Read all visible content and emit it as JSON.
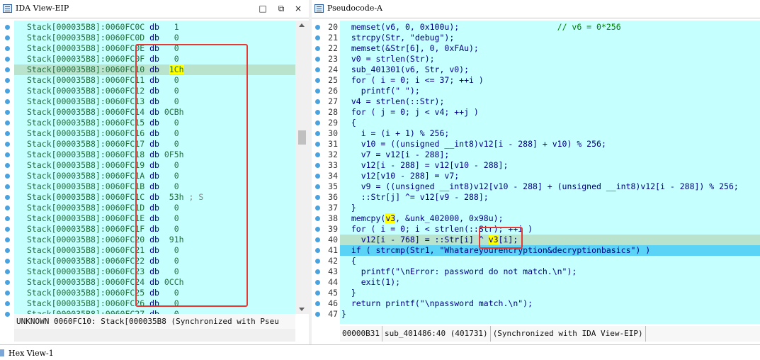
{
  "left_panel": {
    "title": "IDA View-EIP",
    "minimize_glyph": "□",
    "restore_glyph": "⧉",
    "close_glyph": "×",
    "lines": [
      {
        "addr": "Stack[000035B8]:0060FC0C",
        "op": "db",
        "val": "   1",
        "cmt": ""
      },
      {
        "addr": "Stack[000035B8]:0060FC0D",
        "op": "db",
        "val": "   0",
        "cmt": ""
      },
      {
        "addr": "Stack[000035B8]:0060FC0E",
        "op": "db",
        "val": "   0",
        "cmt": ""
      },
      {
        "addr": "Stack[000035B8]:0060FC0F",
        "op": "db",
        "val": "   0",
        "cmt": ""
      },
      {
        "addr": "Stack[000035B8]:0060FC10",
        "op": "db",
        "val": "  1Ch",
        "cmt": ""
      },
      {
        "addr": "Stack[000035B8]:0060FC11",
        "op": "db",
        "val": "   0",
        "cmt": ""
      },
      {
        "addr": "Stack[000035B8]:0060FC12",
        "op": "db",
        "val": "   0",
        "cmt": ""
      },
      {
        "addr": "Stack[000035B8]:0060FC13",
        "op": "db",
        "val": "   0",
        "cmt": ""
      },
      {
        "addr": "Stack[000035B8]:0060FC14",
        "op": "db",
        "val": " 0CBh",
        "cmt": ""
      },
      {
        "addr": "Stack[000035B8]:0060FC15",
        "op": "db",
        "val": "   0",
        "cmt": ""
      },
      {
        "addr": "Stack[000035B8]:0060FC16",
        "op": "db",
        "val": "   0",
        "cmt": ""
      },
      {
        "addr": "Stack[000035B8]:0060FC17",
        "op": "db",
        "val": "   0",
        "cmt": ""
      },
      {
        "addr": "Stack[000035B8]:0060FC18",
        "op": "db",
        "val": " 0F5h",
        "cmt": ""
      },
      {
        "addr": "Stack[000035B8]:0060FC19",
        "op": "db",
        "val": "   0",
        "cmt": ""
      },
      {
        "addr": "Stack[000035B8]:0060FC1A",
        "op": "db",
        "val": "   0",
        "cmt": ""
      },
      {
        "addr": "Stack[000035B8]:0060FC1B",
        "op": "db",
        "val": "   0",
        "cmt": ""
      },
      {
        "addr": "Stack[000035B8]:0060FC1C",
        "op": "db",
        "val": "  53h",
        "cmt": " ; S"
      },
      {
        "addr": "Stack[000035B8]:0060FC1D",
        "op": "db",
        "val": "   0",
        "cmt": ""
      },
      {
        "addr": "Stack[000035B8]:0060FC1E",
        "op": "db",
        "val": "   0",
        "cmt": ""
      },
      {
        "addr": "Stack[000035B8]:0060FC1F",
        "op": "db",
        "val": "   0",
        "cmt": ""
      },
      {
        "addr": "Stack[000035B8]:0060FC20",
        "op": "db",
        "val": "  91h",
        "cmt": ""
      },
      {
        "addr": "Stack[000035B8]:0060FC21",
        "op": "db",
        "val": "   0",
        "cmt": ""
      },
      {
        "addr": "Stack[000035B8]:0060FC22",
        "op": "db",
        "val": "   0",
        "cmt": ""
      },
      {
        "addr": "Stack[000035B8]:0060FC23",
        "op": "db",
        "val": "   0",
        "cmt": ""
      },
      {
        "addr": "Stack[000035B8]:0060FC24",
        "op": "db",
        "val": " 0CCh",
        "cmt": ""
      },
      {
        "addr": "Stack[000035B8]:0060FC25",
        "op": "db",
        "val": "   0",
        "cmt": ""
      },
      {
        "addr": "Stack[000035B8]:0060FC26",
        "op": "db",
        "val": "   0",
        "cmt": ""
      },
      {
        "addr": "Stack[000035B8]:0060FC27",
        "op": "db",
        "val": "   0",
        "cmt": ""
      }
    ],
    "status_text": "UNKNOWN 0060FC10: Stack[000035B8 (Synchronized with Pseu"
  },
  "right_panel": {
    "title": "Pseudocode-A",
    "lines": [
      {
        "num": "20",
        "code": "  memset(v6, 0, 0x100u);                    // v6 = 0*256"
      },
      {
        "num": "21",
        "code": "  strcpy(Str, \"debug\");"
      },
      {
        "num": "22",
        "code": "  memset(&Str[6], 0, 0xFAu);"
      },
      {
        "num": "23",
        "code": "  v0 = strlen(Str);"
      },
      {
        "num": "24",
        "code": "  sub_401301(v6, Str, v0);"
      },
      {
        "num": "25",
        "code": "  for ( i = 0; i <= 37; ++i )"
      },
      {
        "num": "26",
        "code": "    printf(\" \");"
      },
      {
        "num": "27",
        "code": "  v4 = strlen(::Str);"
      },
      {
        "num": "28",
        "code": "  for ( j = 0; j < v4; ++j )"
      },
      {
        "num": "29",
        "code": "  {"
      },
      {
        "num": "30",
        "code": "    i = (i + 1) % 256;"
      },
      {
        "num": "31",
        "code": "    v10 = ((unsigned __int8)v12[i - 288] + v10) % 256;"
      },
      {
        "num": "32",
        "code": "    v7 = v12[i - 288];"
      },
      {
        "num": "33",
        "code": "    v12[i - 288] = v12[v10 - 288];"
      },
      {
        "num": "34",
        "code": "    v12[v10 - 288] = v7;"
      },
      {
        "num": "35",
        "code": "    v9 = ((unsigned __int8)v12[v10 - 288] + (unsigned __int8)v12[i - 288]) % 256;"
      },
      {
        "num": "36",
        "code": "    ::Str[j] ^= v12[v9 - 288];"
      },
      {
        "num": "37",
        "code": "  }"
      },
      {
        "num": "38",
        "code": "  memcpy(v3, &unk_402000, 0x98u);"
      },
      {
        "num": "39",
        "code": "  for ( i = 0; i < strlen(::Str); ++i )"
      },
      {
        "num": "40",
        "code": "    v12[i - 768] = ::Str[i] ^ v3[i];"
      },
      {
        "num": "41",
        "code": "  if ( strcmp(Str1, \"Whatareyourencryption&decryptionbasics\") )"
      },
      {
        "num": "42",
        "code": "  {"
      },
      {
        "num": "43",
        "code": "    printf(\"\\nError: password do not match.\\n\");"
      },
      {
        "num": "44",
        "code": "    exit(1);"
      },
      {
        "num": "45",
        "code": "  }"
      },
      {
        "num": "46",
        "code": "  return printf(\"\\npassword match.\\n\");"
      },
      {
        "num": "47",
        "code": "}"
      }
    ],
    "status_segments": [
      "00000B31",
      "sub_401486:40 (401731)",
      "(Synchronized with IDA View-EIP)"
    ]
  },
  "bottom_bar": {
    "title": "Hex View-1"
  },
  "colors": {
    "code_bg": "#c5fffe",
    "selected_line": "#b9e3cc",
    "current_line": "#5ad3f7",
    "annotation_red": "#e53935",
    "highlight_yellow": "#ffff00"
  }
}
